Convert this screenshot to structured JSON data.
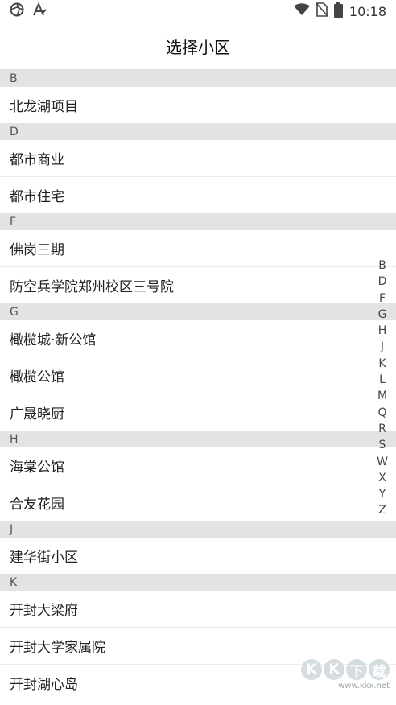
{
  "status_bar": {
    "left_icons": [
      "aperture-icon",
      "a-icon"
    ],
    "right_icons": [
      "wifi-icon",
      "no-sim-icon",
      "battery-icon"
    ],
    "time": "10:18"
  },
  "title": "选择小区",
  "sections": [
    {
      "letter": "B",
      "items": [
        "北龙湖项目"
      ]
    },
    {
      "letter": "D",
      "items": [
        "都市商业",
        "都市住宅"
      ]
    },
    {
      "letter": "F",
      "items": [
        "佛岗三期",
        "防空兵学院郑州校区三号院"
      ]
    },
    {
      "letter": "G",
      "items": [
        "橄榄城·新公馆",
        "橄榄公馆",
        "广晟晓厨"
      ]
    },
    {
      "letter": "H",
      "items": [
        "海棠公馆",
        "合友花园"
      ]
    },
    {
      "letter": "J",
      "items": [
        "建华街小区"
      ]
    },
    {
      "letter": "K",
      "items": [
        "开封大梁府",
        "开封大学家属院",
        "开封湖心岛"
      ]
    }
  ],
  "index_letters": [
    "B",
    "D",
    "F",
    "G",
    "H",
    "J",
    "K",
    "L",
    "M",
    "Q",
    "R",
    "S",
    "W",
    "X",
    "Y",
    "Z"
  ],
  "watermark": {
    "logo": [
      "K",
      "K",
      "下",
      "载"
    ],
    "url": "www.kkx.net"
  }
}
